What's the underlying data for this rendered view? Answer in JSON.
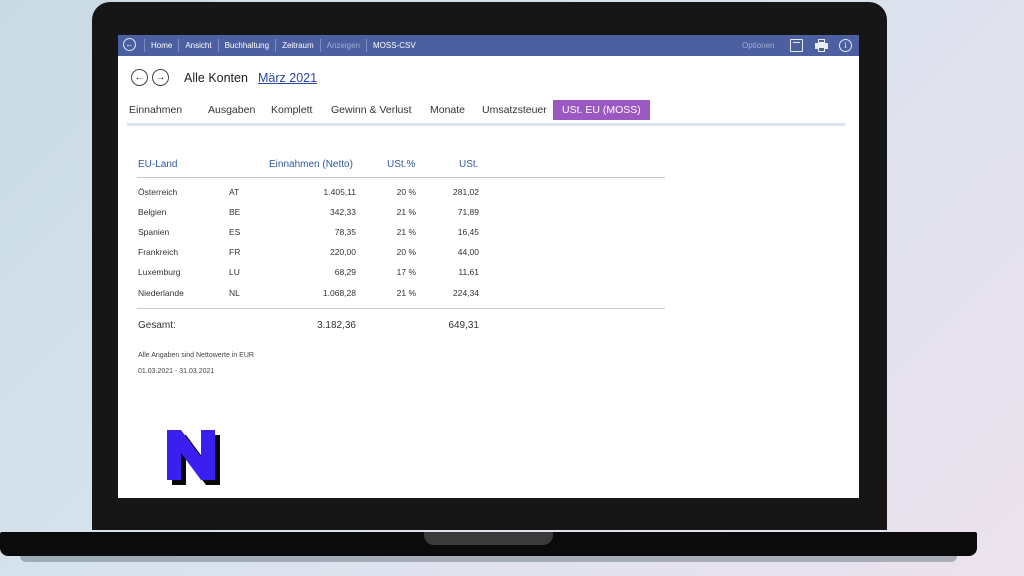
{
  "toolbar": {
    "menu": [
      "Home",
      "Ansicht",
      "Buchhaltung",
      "Zeitraum",
      "Anzeigen",
      "MOSS-CSV"
    ],
    "disabled": [
      "Anzeigen"
    ],
    "options_label": "Optionen",
    "icons": [
      "back-icon",
      "window-icon",
      "print-icon",
      "info-icon"
    ]
  },
  "header": {
    "title": "Alle Konten",
    "period": "März 2021"
  },
  "tabs": [
    "Einnahmen",
    "Ausgaben",
    "Komplett",
    "Gewinn & Verlust",
    "Monate",
    "Umsatzsteuer",
    "USt. EU (MOSS)"
  ],
  "active_tab": "USt. EU (MOSS)",
  "table": {
    "headers": {
      "country": "EU-Land",
      "income": "Einnahmen (Netto)",
      "rate": "USt.%",
      "tax": "USt."
    },
    "rows": [
      {
        "country": "Österreich",
        "code": "AT",
        "income": "1.405,11",
        "rate": "20 %",
        "tax": "281,02"
      },
      {
        "country": "Belgien",
        "code": "BE",
        "income": "342,33",
        "rate": "21 %",
        "tax": "71,89"
      },
      {
        "country": "Spanien",
        "code": "ES",
        "income": "78,35",
        "rate": "21 %",
        "tax": "16,45"
      },
      {
        "country": "Frankreich",
        "code": "FR",
        "income": "220,00",
        "rate": "20 %",
        "tax": "44,00"
      },
      {
        "country": "Luxemburg",
        "code": "LU",
        "income": "68,29",
        "rate": "17 %",
        "tax": "11,61"
      },
      {
        "country": "Niederlande",
        "code": "NL",
        "income": "1.068,28",
        "rate": "21 %",
        "tax": "224,34"
      }
    ],
    "total_label": "Gesamt:",
    "total_income": "3.182,36",
    "total_tax": "649,31"
  },
  "notes": {
    "currency_note": "Alle Angaben sind Nettowerte in EUR",
    "date_range": "01.03.2021 - 31.03.2021"
  },
  "colors": {
    "toolbar": "#4c5fa1",
    "active_tab": "#9b57c2",
    "header_text": "#2f5aa0",
    "link": "#2747a3",
    "logo_fill": "#3b1ff0"
  },
  "logo": {
    "letter": "N"
  }
}
